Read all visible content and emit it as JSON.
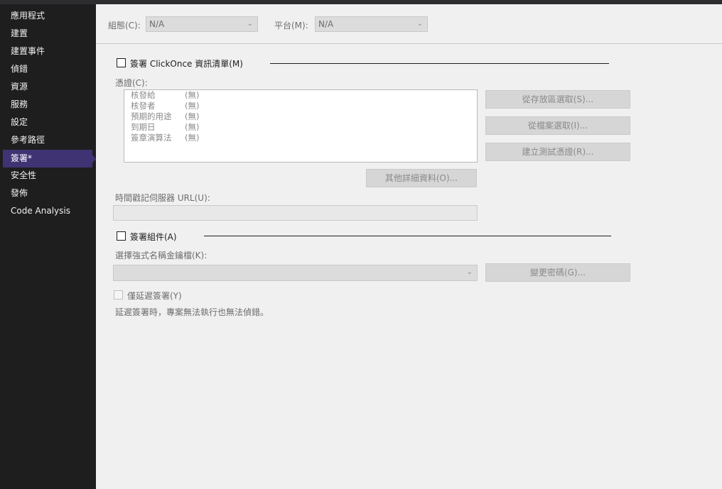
{
  "sidebar": {
    "items": [
      {
        "label": "應用程式"
      },
      {
        "label": "建置"
      },
      {
        "label": "建置事件"
      },
      {
        "label": "偵錯"
      },
      {
        "label": "資源"
      },
      {
        "label": "服務"
      },
      {
        "label": "設定"
      },
      {
        "label": "參考路徑"
      },
      {
        "label": "簽署*"
      },
      {
        "label": "安全性"
      },
      {
        "label": "發佈"
      },
      {
        "label": "Code Analysis"
      }
    ],
    "active_index": 8
  },
  "config": {
    "configuration_label": "組態(C):",
    "configuration_value": "N/A",
    "platform_label": "平台(M):",
    "platform_value": "N/A"
  },
  "clickonce": {
    "checkbox_label": "簽署 ClickOnce 資訊清單(M)",
    "checked": false,
    "certificate_label": "憑證(C):",
    "certificate_rows": [
      {
        "key": "核發給",
        "value": "(無)"
      },
      {
        "key": "核發者",
        "value": "(無)"
      },
      {
        "key": "預期的用途",
        "value": "(無)"
      },
      {
        "key": "到期日",
        "value": "(無)"
      },
      {
        "key": "簽章演算法",
        "value": "(無)"
      }
    ],
    "from_store_button": "從存放區選取(S)...",
    "from_file_button": "從檔案選取(I)...",
    "create_test_button": "建立測試憑證(R)...",
    "more_details_button": "其他詳細資料(O)...",
    "timestamp_label": "時間戳記伺服器 URL(U):",
    "timestamp_value": ""
  },
  "assembly": {
    "checkbox_label": "簽署組件(A)",
    "checked": false,
    "key_file_label": "選擇強式名稱金鑰檔(K):",
    "key_file_value": "",
    "change_password_button": "變更密碼(G)...",
    "delay_sign_label": "僅延遲簽署(Y)",
    "delay_sign_checked": false,
    "delay_sign_note": "延遲簽署時，專案無法執行也無法偵錯。"
  }
}
